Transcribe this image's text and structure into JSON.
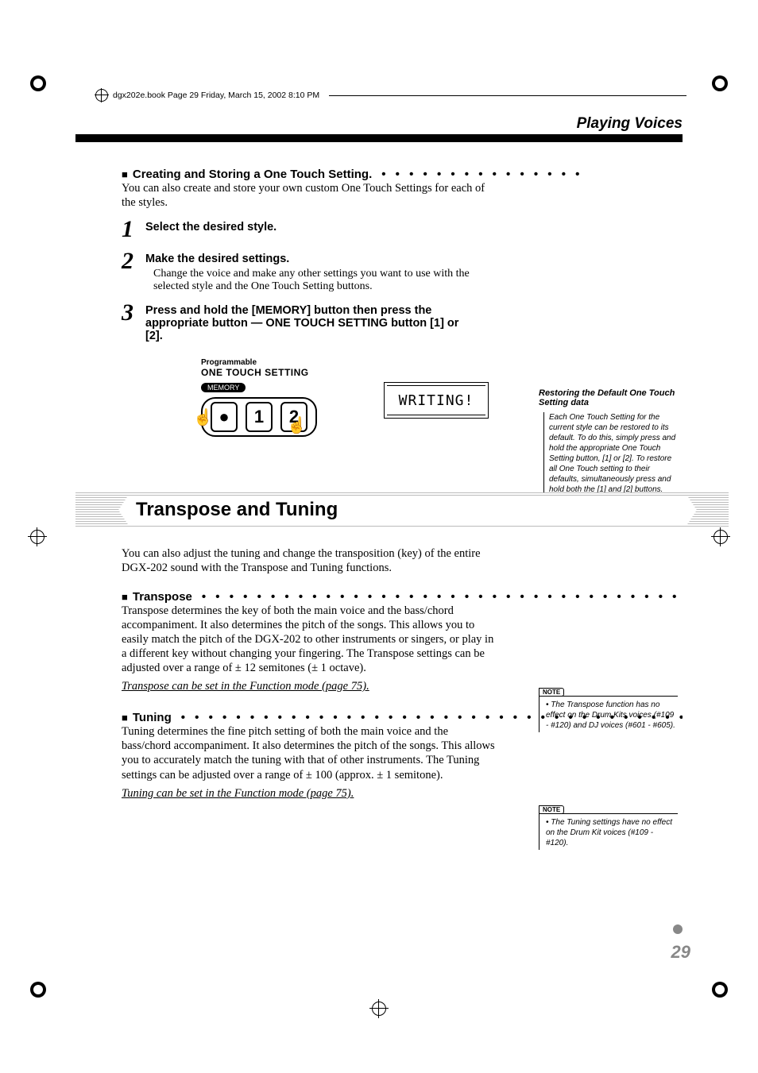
{
  "meta": {
    "header_line": "dgx202e.book  Page 29  Friday, March 15, 2002  8:10 PM"
  },
  "chapter": "Playing Voices",
  "s1": {
    "heading": "Creating and Storing a One Touch Setting.",
    "intro": "You can also create and store your own custom One Touch Settings for each of the styles.",
    "steps": {
      "n1": "1",
      "t1": "Select the desired style.",
      "n2": "2",
      "t2": "Make the desired settings.",
      "b2": "Change the voice and make any other settings you want to use with the selected style and the One Touch Setting buttons.",
      "n3": "3",
      "t3": "Press and hold the [MEMORY] button then press the appropriate button — ONE TOUCH SETTING button [1] or [2]."
    },
    "graphic": {
      "label_small": "Programmable",
      "label_big": "ONE TOUCH SETTING",
      "memory": "MEMORY",
      "b_dot": "●",
      "b1": "1",
      "b2": "2",
      "lcd": "WRITING!"
    },
    "sidenote": {
      "title": "Restoring the Default One Touch Setting data",
      "body": "Each One Touch Setting for the current style can be restored to its default. To do this, simply press and hold the appropriate One Touch Setting button, [1] or [2]. To restore all One Touch setting to their defaults, simultaneously press and hold both the [1] and [2] buttons."
    }
  },
  "s2": {
    "title": "Transpose and Tuning",
    "intro": "You can also adjust the tuning and change the transposition (key) of the entire DGX-202 sound with the Transpose and Tuning functions.",
    "transpose": {
      "heading": "Transpose",
      "body": "Transpose determines the key of both the main voice and the bass/chord accompaniment.  It also determines the pitch of the songs.  This allows you to easily match the pitch of the DGX-202 to other instruments or singers, or play in a different key without changing your fingering.  The Transpose settings can be adjusted over a range of ± 12 semitones (± 1 octave).",
      "link": "Transpose can be set in the Function mode (page 75).",
      "note_label": "NOTE",
      "note": "The Transpose function has no effect on the Drum Kits voices (#109 - #120) and DJ voices (#601 - #605)."
    },
    "tuning": {
      "heading": "Tuning",
      "body": "Tuning determines the fine pitch setting of both the main voice and the bass/chord accompaniment.  It also determines the pitch of the songs.  This allows you to accurately match the tuning with that of other instruments.  The Tuning settings can be adjusted over a range of ± 100 (approx. ± 1 semitone).",
      "link": "Tuning can be set in the Function mode (page 75).",
      "note_label": "NOTE",
      "note": "The Tuning settings have no effect on the Drum Kit voices (#109 - #120)."
    }
  },
  "page_number": "29"
}
